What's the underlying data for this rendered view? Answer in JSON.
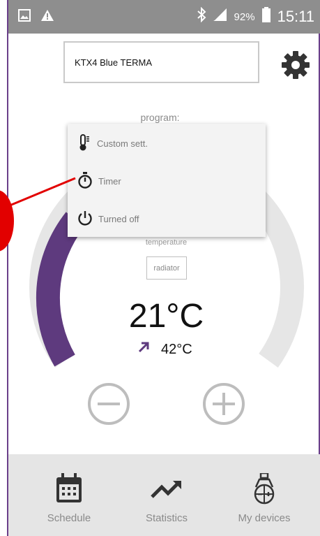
{
  "status_bar": {
    "battery_percent": "92%",
    "time": "15:11"
  },
  "header": {
    "device_name": "KTX4 Blue TERMA"
  },
  "program": {
    "label": "program:",
    "menu": [
      {
        "label": "Custom sett.",
        "icon": "thermometer-icon"
      },
      {
        "label": "Timer",
        "icon": "stopwatch-icon"
      },
      {
        "label": "Turned off",
        "icon": "power-icon"
      }
    ]
  },
  "gauge": {
    "temperature_label": "temperature",
    "mode": "radiator",
    "current_temp": "21°C",
    "target_temp": "42°C",
    "accent_color": "#5e3a7e",
    "track_color": "#e6e6e6"
  },
  "bottom_nav": [
    {
      "label": "Schedule",
      "icon": "calendar-icon"
    },
    {
      "label": "Statistics",
      "icon": "trend-chart-icon"
    },
    {
      "label": "My devices",
      "icon": "device-icon"
    }
  ]
}
